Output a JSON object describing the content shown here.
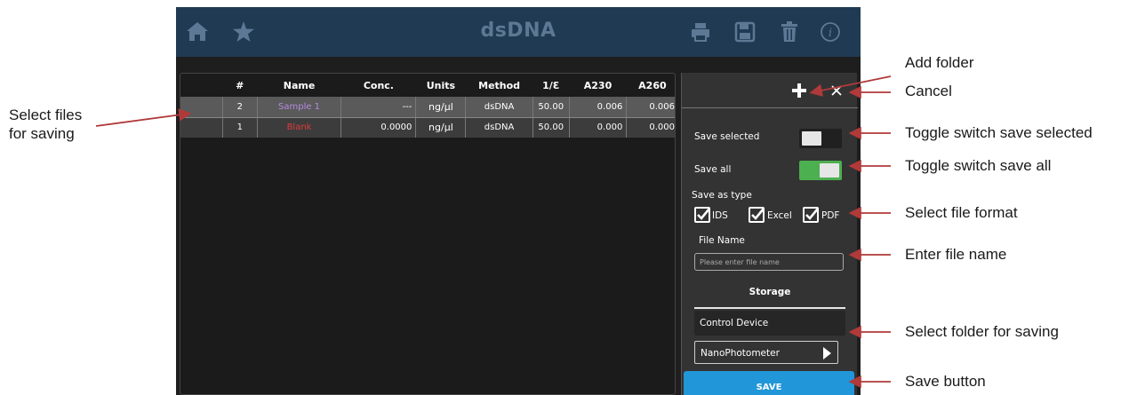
{
  "colors": {
    "topbar": "#1f3a52",
    "topbar_icon": "#5c7894",
    "screen_bg": "#1e1e1e",
    "panel_bg": "#333333",
    "toggle_on": "#4caf50",
    "save_button": "#2196d8",
    "annotation_arrow": "#b03a3a",
    "sample_name": "#b58be0",
    "blank_name": "#e03a3a"
  },
  "topbar": {
    "title": "dsDNA",
    "left_icons": [
      "home-icon",
      "star-icon"
    ],
    "right_icons": [
      "print-icon",
      "save-disk-icon",
      "trash-icon",
      "info-icon"
    ]
  },
  "table": {
    "columns": [
      "#",
      "Name",
      "Conc.",
      "Units",
      "Method",
      "1/Ɛ",
      "A230",
      "A260"
    ],
    "rows": [
      {
        "num": "2",
        "name": "Sample 1",
        "conc": "---",
        "units": "ng/μl",
        "method": "dsDNA",
        "factor": "50.00",
        "a230": "0.006",
        "a260": "0.006"
      },
      {
        "num": "1",
        "name": "Blank",
        "conc": "0.0000",
        "units": "ng/μl",
        "method": "dsDNA",
        "factor": "50.00",
        "a230": "0.000",
        "a260": "0.000"
      }
    ]
  },
  "save_panel": {
    "add_folder_icon": "plus-icon",
    "cancel_icon": "close-icon",
    "save_selected": {
      "label": "Save selected",
      "on": false
    },
    "save_all": {
      "label": "Save all",
      "on": true
    },
    "save_as_type_label": "Save as type",
    "types": [
      {
        "label": "IDS",
        "checked": true
      },
      {
        "label": "Excel",
        "checked": true
      },
      {
        "label": "PDF",
        "checked": true
      }
    ],
    "file_name_label": "File Name",
    "file_name_value": "",
    "file_name_placeholder": "Please enter file name",
    "storage_label": "Storage",
    "control_device": "Control Device",
    "folder": "NanoPhotometer",
    "save_button": "SAVE"
  },
  "annotations": {
    "select_files": [
      "Select files",
      "for saving"
    ],
    "add_folder": "Add folder",
    "cancel": "Cancel",
    "toggle_selected": "Toggle switch save selected",
    "toggle_all": "Toggle switch save all",
    "file_format": "Select file format",
    "file_name": "Enter file name",
    "folder": "Select folder for saving",
    "save_button": "Save button"
  }
}
